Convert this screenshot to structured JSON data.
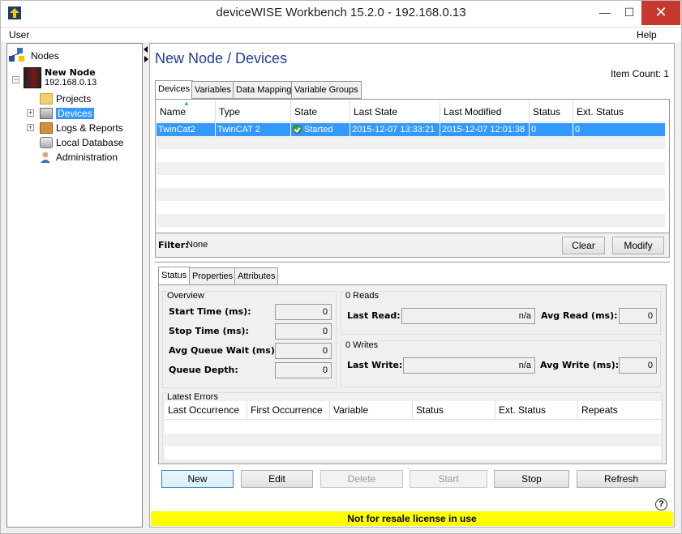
{
  "window": {
    "title": "deviceWISE Workbench 15.2.0  -  192.168.0.13"
  },
  "menu": {
    "user": "User",
    "help": "Help"
  },
  "tree": {
    "root": "Nodes",
    "node_name": "New Node",
    "node_ip": "192.168.0.13",
    "items": [
      "Projects",
      "Devices",
      "Logs & Reports",
      "Local Database",
      "Administration"
    ]
  },
  "main": {
    "title": "New Node / Devices",
    "item_count": "Item Count: 1",
    "tabs": [
      "Devices",
      "Variables",
      "Data Mapping",
      "Variable Groups"
    ],
    "columns": [
      "Name",
      "Type",
      "State",
      "Last State Changed",
      "Last Modified",
      "Status",
      "Ext. Status"
    ],
    "rows": [
      {
        "name": "TwinCat2",
        "type": "TwinCAT 2",
        "state": "Started",
        "changed": "2015-12-07 13:33:21",
        "modified": "2015-12-07 12:01:38",
        "status": "0",
        "ext": "0"
      }
    ],
    "filter_label": "Filter:",
    "filter_value": "None",
    "clear": "Clear",
    "modify": "Modify"
  },
  "detail": {
    "tabs": [
      "Status",
      "Properties",
      "Attributes"
    ],
    "overview": {
      "title": "Overview",
      "start_label": "Start Time (ms):",
      "start": "0",
      "stop_label": "Stop Time (ms):",
      "stop": "0",
      "queue_wait_label": "Avg Queue Wait (ms):",
      "queue_wait": "0",
      "depth_label": "Queue Depth:",
      "depth": "0"
    },
    "reads": {
      "title": "0 Reads",
      "last_label": "Last Read:",
      "last": "n/a",
      "avg_label": "Avg Read (ms):",
      "avg": "0"
    },
    "writes": {
      "title": "0 Writes",
      "last_label": "Last Write:",
      "last": "n/a",
      "avg_label": "Avg Write (ms):",
      "avg": "0"
    },
    "errors": {
      "title": "Latest Errors",
      "columns": [
        "Last Occurrence",
        "First Occurrence",
        "Variable",
        "Status",
        "Ext. Status",
        "Repeats"
      ]
    }
  },
  "buttons": {
    "new": "New",
    "edit": "Edit",
    "delete": "Delete",
    "start": "Start",
    "stop": "Stop",
    "refresh": "Refresh"
  },
  "license": "Not for resale license in use",
  "colors": {
    "title_blue": "#1f3e8f",
    "selection": "#3399ff",
    "license_bg": "#ffff00",
    "close_red": "#c7372f"
  }
}
